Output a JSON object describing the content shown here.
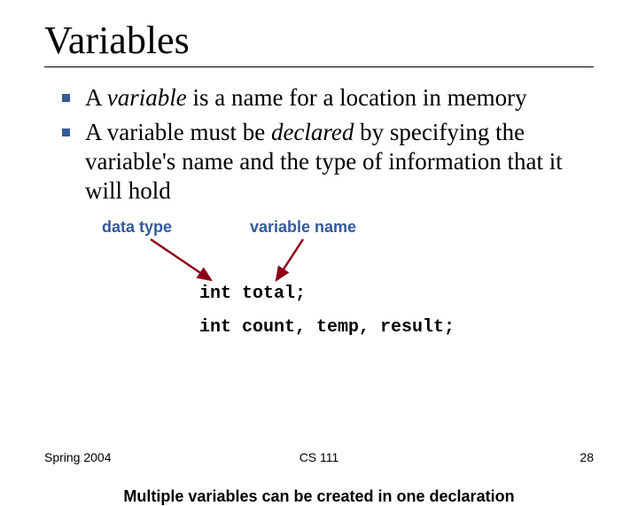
{
  "title": "Variables",
  "bullets": [
    {
      "a": "A ",
      "b": "variable",
      "c": " is a name for a location in memory"
    },
    {
      "a": "A variable must be ",
      "b": "declared",
      "c": " by specifying the variable's name and the type of information that it will hold"
    }
  ],
  "labels": {
    "data_type": "data type",
    "variable_name": "variable name"
  },
  "code": {
    "line1": "int total;",
    "line2": "int count, temp, result;"
  },
  "caption": "Multiple variables can be created in one declaration",
  "footer": {
    "left": "Spring 2004",
    "center": "CS 111",
    "right": "28"
  }
}
